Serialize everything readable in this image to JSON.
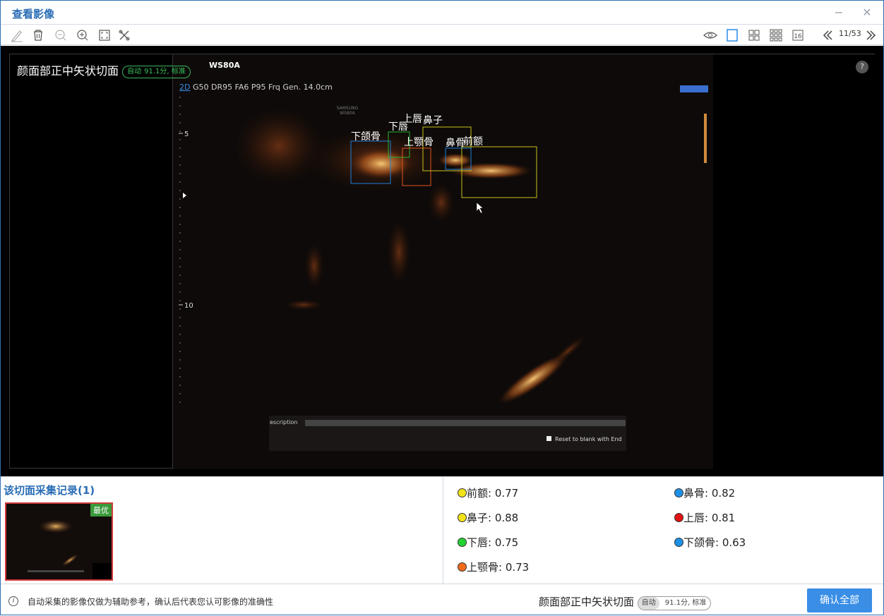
{
  "window": {
    "title": "查看影像",
    "minimize": "−",
    "close": "✕"
  },
  "toolbar": {
    "page": "11/53",
    "grid16": "16"
  },
  "viewer": {
    "plane_name": "颜面部正中矢状切面",
    "badge_auto": "自动",
    "badge_score": "91.1分, 标准",
    "device": "WS80A",
    "mode_2d": "2D",
    "params": " G50 DR95 FA6 P95 Frq Gen. 14.0cm",
    "depth_5": "5",
    "depth_10": "10",
    "samsung": "SAMSUNG",
    "samsung_model": "WS80A",
    "description_label": "escription",
    "reset_label": "Reset to blank with End",
    "help": "?",
    "labels": {
      "mandible": "下颌骨",
      "lower_lip": "下唇",
      "upper_lip": "上唇",
      "nose": "鼻子",
      "maxilla": "上颚骨",
      "nasal_bone": "鼻骨",
      "forehead": "前额"
    }
  },
  "record": {
    "title": "该切面采集记录(1)",
    "best_tag": "最优"
  },
  "scores": [
    {
      "label": "前额: 0.77",
      "color": "#f2e21a"
    },
    {
      "label": "鼻子: 0.88",
      "color": "#f2e21a"
    },
    {
      "label": "下唇: 0.75",
      "color": "#22d133"
    },
    {
      "label": "上颚骨: 0.73",
      "color": "#f06a1c"
    },
    {
      "label": "鼻骨: 0.82",
      "color": "#1e90e6"
    },
    {
      "label": "上唇: 0.81",
      "color": "#e31212"
    },
    {
      "label": "下颌骨: 0.63",
      "color": "#1e90e6"
    }
  ],
  "footer": {
    "notice": "自动采集的影像仅做为辅助参考，确认后代表您认可影像的准确性",
    "plane_name": "颜面部正中矢状切面",
    "badge_auto": "自动",
    "badge_score": "91.1分, 标准",
    "confirm": "确认全部"
  }
}
